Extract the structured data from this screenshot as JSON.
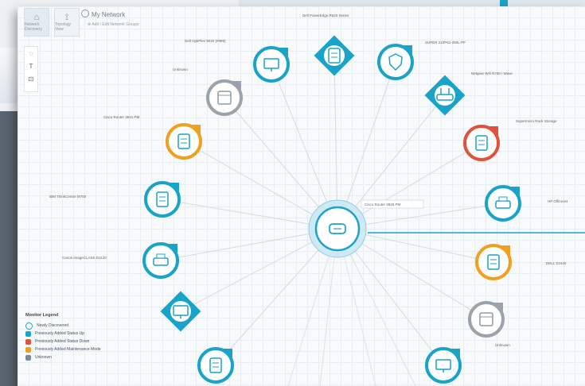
{
  "window": {
    "title": "My Network"
  },
  "toolbar": {
    "buttons": [
      {
        "label": "Network Discovery",
        "icon": "network-icon"
      },
      {
        "label": "Topology View",
        "icon": "topology-icon"
      }
    ],
    "add_label": "Add / Edit Network Groups"
  },
  "sidebar": {
    "tools": [
      "lasso-icon",
      "text-icon",
      "select-icon"
    ]
  },
  "hub": {
    "label": "Cisco Router 3925 PM"
  },
  "devices": [
    {
      "label": "Dell PowerEdge R620 Series",
      "shape": "diamond",
      "status": "up",
      "icon": "server-icon"
    },
    {
      "label": "Dell OptiPlex 9020 (#889)",
      "shape": "circle",
      "status": "up",
      "icon": "monitor-icon"
    },
    {
      "label": "SUPER 210P61-250L-PF",
      "shape": "circle",
      "status": "up",
      "icon": "shield-icon"
    },
    {
      "label": "Unknown",
      "shape": "circle",
      "status": "unknown",
      "icon": "box-icon"
    },
    {
      "label": "Netgear Wifi N750 / Wave",
      "shape": "diamond",
      "status": "up",
      "icon": "router-icon"
    },
    {
      "label": "Cisco Router 3921 PM",
      "shape": "circle",
      "status": "maintenance",
      "icon": "server-icon"
    },
    {
      "label": "Supermicro Rack Storage",
      "shape": "circle",
      "status": "down",
      "icon": "storage-icon"
    },
    {
      "label": "IBM ThinkCentre M700",
      "shape": "circle",
      "status": "up",
      "icon": "server-icon"
    },
    {
      "label": "HP OfficeJet",
      "shape": "circle",
      "status": "up",
      "icon": "printer-icon"
    },
    {
      "label": "Canon imageCLASS D1120",
      "shape": "circle",
      "status": "up",
      "icon": "printer-icon"
    },
    {
      "label": "DELL S2440",
      "shape": "circle",
      "status": "maintenance",
      "icon": "server-icon"
    },
    {
      "label": "",
      "shape": "diamond",
      "status": "up",
      "icon": "monitor-icon"
    },
    {
      "label": "Unknown",
      "shape": "circle",
      "status": "unknown",
      "icon": "box-icon"
    },
    {
      "label": "",
      "shape": "circle",
      "status": "up",
      "icon": "server-icon"
    },
    {
      "label": "",
      "shape": "circle",
      "status": "up",
      "icon": "monitor-icon"
    }
  ],
  "legend": {
    "title": "Monitor Legend",
    "items": [
      {
        "label": "Newly Discovered",
        "color": "#1aa3c9",
        "style": "outline"
      },
      {
        "label": "Previously Added Status Up",
        "color": "#1aa3c9",
        "style": "fill"
      },
      {
        "label": "Previously Added Status Down",
        "color": "#e0523b",
        "style": "fill"
      },
      {
        "label": "Previously Added Maintenance Mode",
        "color": "#f0a020",
        "style": "fill"
      },
      {
        "label": "Unknown",
        "color": "#7b8794",
        "style": "fill"
      }
    ]
  },
  "colors": {
    "up": "#1aa3c9",
    "down": "#e0523b",
    "maintenance": "#f0a020",
    "unknown": "#9aa3ab"
  }
}
